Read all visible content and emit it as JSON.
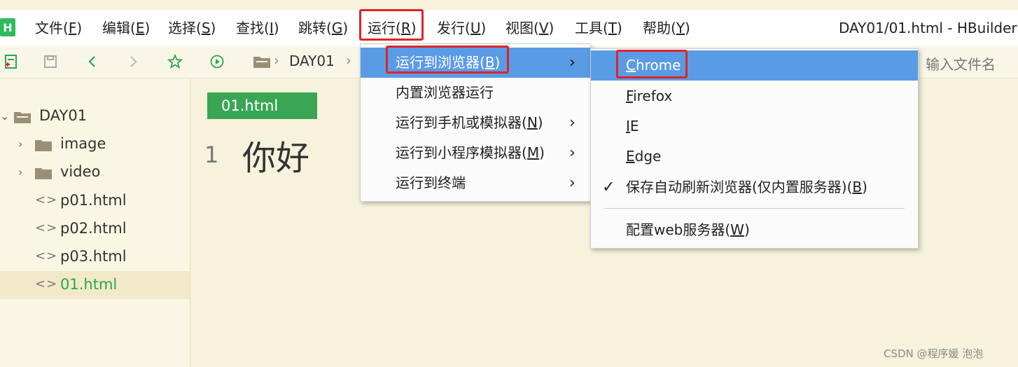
{
  "app": {
    "logo_letter": "H",
    "window_title": "DAY01/01.html - HBuilder"
  },
  "menubar": {
    "items": [
      {
        "label": "文件(",
        "key": "F",
        "tail": ")"
      },
      {
        "label": "编辑(",
        "key": "E",
        "tail": ")"
      },
      {
        "label": "选择(",
        "key": "S",
        "tail": ")"
      },
      {
        "label": "查找(",
        "key": "I",
        "tail": ")"
      },
      {
        "label": "跳转(",
        "key": "G",
        "tail": ")"
      },
      {
        "label": "运行(",
        "key": "R",
        "tail": ")"
      },
      {
        "label": "发行(",
        "key": "U",
        "tail": ")"
      },
      {
        "label": "视图(",
        "key": "V",
        "tail": ")"
      },
      {
        "label": "工具(",
        "key": "T",
        "tail": ")"
      },
      {
        "label": "帮助(",
        "key": "Y",
        "tail": ")"
      }
    ]
  },
  "toolbar": {
    "breadcrumb": "DAY01",
    "file_search_placeholder": "输入文件名"
  },
  "sidebar": {
    "items": [
      {
        "label": "DAY01",
        "type": "folder-open"
      },
      {
        "label": "image",
        "type": "folder"
      },
      {
        "label": "video",
        "type": "folder"
      },
      {
        "label": "p01.html",
        "type": "file"
      },
      {
        "label": "p02.html",
        "type": "file"
      },
      {
        "label": "p03.html",
        "type": "file"
      },
      {
        "label": "01.html",
        "type": "file",
        "active": true
      }
    ]
  },
  "editor": {
    "tab_label": "01.html",
    "line_number": "1",
    "line_text": "你好"
  },
  "run_menu": {
    "items": [
      {
        "label": "运行到浏览器(",
        "key": "B",
        "tail": ")",
        "submenu": true,
        "highlighted": true
      },
      {
        "label": "内置浏览器运行",
        "key": "",
        "tail": "",
        "submenu": false
      },
      {
        "label": "运行到手机或模拟器(",
        "key": "N",
        "tail": ")",
        "submenu": true
      },
      {
        "label": "运行到小程序模拟器(",
        "key": "M",
        "tail": ")",
        "submenu": true
      },
      {
        "label": "运行到终端",
        "key": "",
        "tail": "",
        "submenu": true
      }
    ]
  },
  "browser_menu": {
    "items": [
      {
        "pre": "",
        "key": "C",
        "label": "hrome",
        "highlighted": true
      },
      {
        "pre": "",
        "key": "F",
        "label": "irefox"
      },
      {
        "pre": "",
        "key": "I",
        "label": "E"
      },
      {
        "pre": "",
        "key": "E",
        "label": "dge"
      }
    ],
    "auto_refresh": {
      "label": "保存自动刷新浏览器(仅内置服务器)(",
      "key": "B",
      "tail": ")",
      "checked": true
    },
    "web_server": {
      "label": "配置web服务器(",
      "key": "W",
      "tail": ")"
    }
  },
  "watermark": "CSDN @程序媛 泡泡",
  "colors": {
    "accent_green": "#3aa655",
    "highlight_blue": "#5a9be6",
    "annotation_red": "#e02424"
  }
}
